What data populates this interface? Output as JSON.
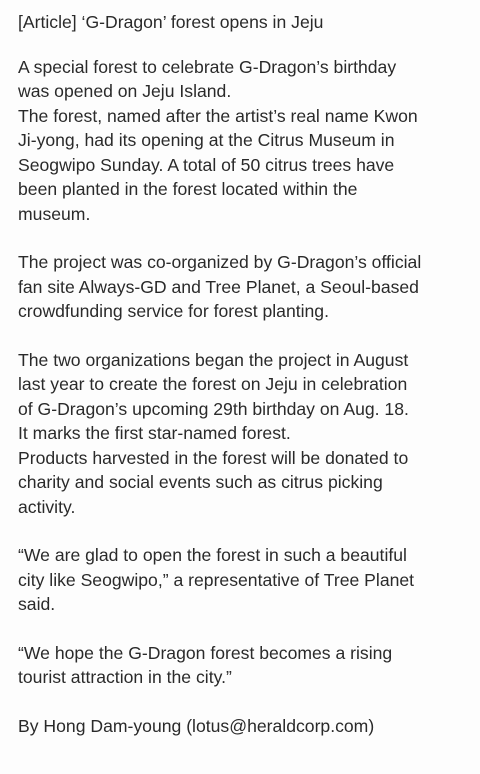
{
  "article": {
    "headline": "[Article] ‘G-Dragon’ forest opens in Jeju",
    "paragraphs": [
      [
        "A special forest to celebrate G-Dragon’s birthday",
        "was opened on Jeju Island.",
        "The forest, named after the artist’s real name Kwon",
        "Ji-yong, had its opening at the Citrus Museum in",
        "Seogwipo Sunday. A total of 50 citrus trees have",
        "been planted in the forest located within the",
        "museum."
      ],
      [
        "The project was co-organized by G-Dragon’s official",
        "fan site Always-GD and Tree Planet, a Seoul-based",
        "crowdfunding service for forest planting."
      ],
      [
        "The two organizations began the project in August",
        "last year to create the forest on Jeju in celebration",
        "of G-Dragon’s upcoming 29th birthday on Aug. 18.",
        "It marks the first star-named forest.",
        "Products harvested in the forest will be donated to",
        "charity and social events such as citrus picking",
        "activity."
      ],
      [
        "“We are glad to open the forest in such a beautiful",
        "city like Seogwipo,” a representative of Tree Planet",
        "said."
      ],
      [
        "“We hope the G-Dragon forest becomes a rising",
        "tourist attraction in the city.”"
      ]
    ],
    "byline": "By Hong Dam-young (lotus@heraldcorp.com)"
  }
}
